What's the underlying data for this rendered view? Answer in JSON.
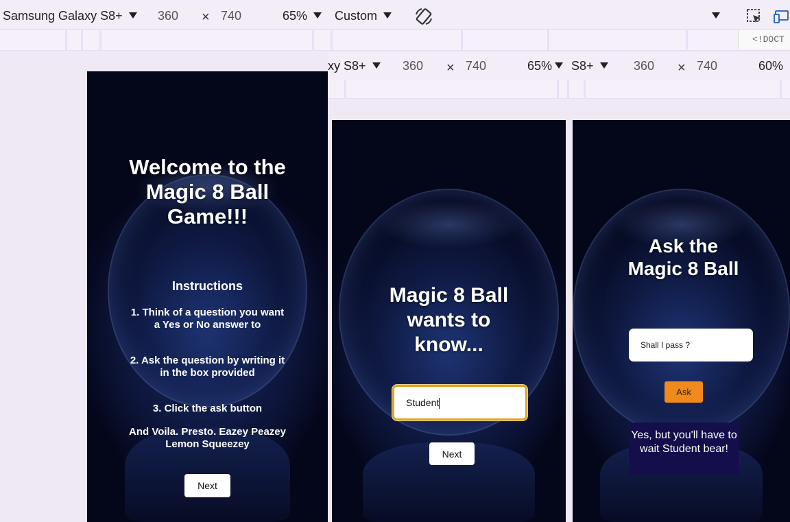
{
  "toolbar": {
    "device": "Samsung Galaxy S8+",
    "width": "360",
    "times": "×",
    "height": "740",
    "zoom": "65%",
    "throttle": "Custom",
    "doctype": "<!DOCT"
  },
  "toolbar2": {
    "device_left": "xy S8+",
    "width_left": "360",
    "height_left": "740",
    "zoom_left": "65%",
    "device_right": "S8+",
    "width_right": "360",
    "height_right": "740",
    "zoom_right": "60%"
  },
  "icons": {
    "rotate": "rotate-icon",
    "inspect": "inspect-element-icon",
    "device_toggle": "device-toggle-icon",
    "dropdown": "chevron-down-icon"
  },
  "screen1": {
    "title": "Welcome to the Magic 8 Ball Game!!!",
    "instructions_heading": "Instructions",
    "step1": "1. Think of a question you want a Yes or No answer to",
    "step2": "2. Ask the question by writing it in the box provided",
    "step3": "3. Click the ask button",
    "outro": "And Voila. Presto. Eazey Peazey Lemon Squeezey",
    "next_label": "Next"
  },
  "screen2": {
    "title": "Magic 8 Ball wants to know...",
    "name_value": "Student",
    "next_label": "Next"
  },
  "screen3": {
    "title": "Ask the Magic 8 Ball",
    "question_value": "Shall I pass ?",
    "ask_label": "Ask",
    "answer": "Yes, but you'll have to wait Student bear!"
  }
}
